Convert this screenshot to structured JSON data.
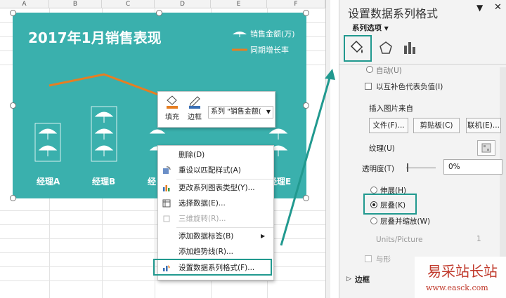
{
  "sheet": {
    "columns": [
      "A",
      "B",
      "C",
      "D",
      "E",
      "F"
    ]
  },
  "chart": {
    "title": "2017年1月销售表现",
    "legend": [
      {
        "label": "销售金额(万)",
        "kind": "umbrella"
      },
      {
        "label": "同期增长率",
        "kind": "line"
      }
    ],
    "categories": [
      "经理A",
      "经理B",
      "经",
      "经理E"
    ],
    "colors": {
      "background": "#3ab0ad",
      "line": "#e67e22",
      "text": "#ffffff"
    }
  },
  "mini_toolbar": {
    "fill_label": "填充",
    "border_label": "边框",
    "series_value": "系列 \"销售金额("
  },
  "context_menu": {
    "items": [
      {
        "label": "删除(D)",
        "icon": "none-icon",
        "enabled": true
      },
      {
        "label": "重设以匹配样式(A)",
        "icon": "reset-style-icon",
        "enabled": true
      },
      {
        "label": "更改系列图表类型(Y)...",
        "icon": "chart-type-icon",
        "enabled": true
      },
      {
        "label": "选择数据(E)...",
        "icon": "select-data-icon",
        "enabled": true
      },
      {
        "label": "三维旋转(R)...",
        "icon": "rotate-3d-icon",
        "enabled": false
      },
      {
        "label": "添加数据标签(B)",
        "icon": "none-icon",
        "enabled": true,
        "submenu": true
      },
      {
        "label": "添加趋势线(R)...",
        "icon": "none-icon",
        "enabled": true
      },
      {
        "label": "设置数据系列格式(F)...",
        "icon": "format-series-icon",
        "enabled": true
      }
    ]
  },
  "pane": {
    "title": "设置数据系列格式",
    "options_label": "系列选项",
    "auto_label": "自动(U)",
    "invert_label": "以互补色代表负值(I)",
    "insert_from_label": "插入图片来自",
    "file_button": "文件(F)...",
    "clipboard_button": "剪贴板(C)",
    "online_button": "联机(E)...",
    "texture_label": "纹理(U)",
    "transparency_label": "透明度(T)",
    "transparency_value": "0%",
    "stretch_label": "伸展(H)",
    "stack_label": "层叠(K)",
    "stack_scale_label": "层叠并缩放(W)",
    "units_label": "Units/Picture",
    "units_value": "1",
    "with_label": "与形",
    "border_section": "边框"
  },
  "watermark": {
    "title": "易采站长站",
    "url": "www.easck.com"
  }
}
